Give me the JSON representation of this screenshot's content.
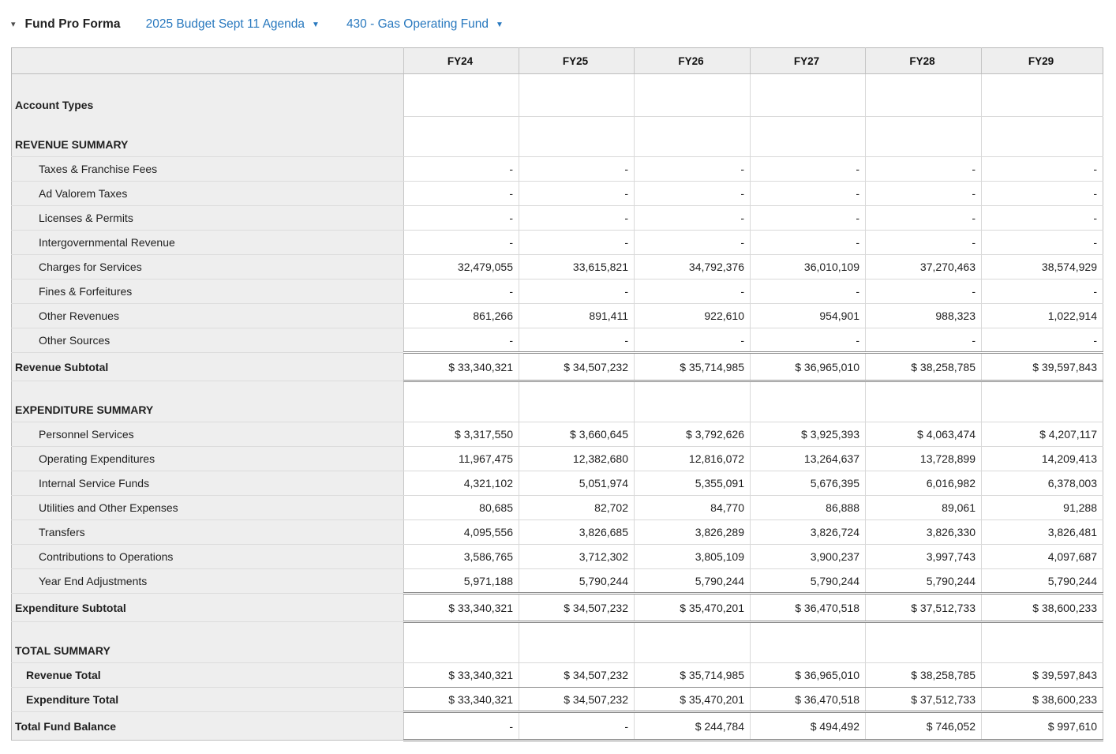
{
  "header": {
    "collapse_icon": "chevron-down-icon",
    "collapse_glyph": "▾",
    "title": "Fund Pro Forma",
    "dropdowns": [
      {
        "label": "2025 Budget Sept 11 Agenda",
        "caret": "▼"
      },
      {
        "label": "430 - Gas Operating Fund",
        "caret": "▼"
      }
    ]
  },
  "colors": {
    "accent_blue": "#2878BE",
    "label_column_bg": "#EEEEEE",
    "grid_border": "#D9D9D9",
    "accounting_border": "#8A8A8A"
  },
  "table": {
    "columns": [
      "FY24",
      "FY25",
      "FY26",
      "FY27",
      "FY28",
      "FY29"
    ],
    "rows": [
      {
        "label": "Account Types",
        "type": "section_start",
        "values": [
          "",
          "",
          "",
          "",
          "",
          ""
        ]
      },
      {
        "label": "REVENUE SUMMARY",
        "type": "section_end",
        "values": [
          "",
          "",
          "",
          "",
          "",
          ""
        ]
      },
      {
        "label": "Taxes & Franchise Fees",
        "type": "detail",
        "values": [
          "-",
          "-",
          "-",
          "-",
          "-",
          "-"
        ]
      },
      {
        "label": "Ad Valorem Taxes",
        "type": "detail",
        "values": [
          "-",
          "-",
          "-",
          "-",
          "-",
          "-"
        ]
      },
      {
        "label": "Licenses & Permits",
        "type": "detail",
        "values": [
          "-",
          "-",
          "-",
          "-",
          "-",
          "-"
        ]
      },
      {
        "label": "Intergovernmental Revenue",
        "type": "detail",
        "values": [
          "-",
          "-",
          "-",
          "-",
          "-",
          "-"
        ]
      },
      {
        "label": "Charges for Services",
        "type": "detail",
        "values": [
          "32,479,055",
          "33,615,821",
          "34,792,376",
          "36,010,109",
          "37,270,463",
          "38,574,929"
        ]
      },
      {
        "label": "Fines & Forfeitures",
        "type": "detail",
        "values": [
          "-",
          "-",
          "-",
          "-",
          "-",
          "-"
        ]
      },
      {
        "label": "Other Revenues",
        "type": "detail",
        "values": [
          "861,266",
          "891,411",
          "922,610",
          "954,901",
          "988,323",
          "1,022,914"
        ]
      },
      {
        "label": "Other Sources",
        "type": "detail",
        "values": [
          "-",
          "-",
          "-",
          "-",
          "-",
          "-"
        ]
      },
      {
        "label": "Revenue Subtotal",
        "type": "subtotal",
        "values": [
          "$ 33,340,321",
          "$ 34,507,232",
          "$ 35,714,985",
          "$ 36,965,010",
          "$ 38,258,785",
          "$ 39,597,843"
        ]
      },
      {
        "label": "EXPENDITURE SUMMARY",
        "type": "section_tall",
        "values": [
          "",
          "",
          "",
          "",
          "",
          ""
        ]
      },
      {
        "label": "Personnel Services",
        "type": "detail",
        "values": [
          "$ 3,317,550",
          "$ 3,660,645",
          "$ 3,792,626",
          "$ 3,925,393",
          "$ 4,063,474",
          "$ 4,207,117"
        ]
      },
      {
        "label": "Operating Expenditures",
        "type": "detail",
        "values": [
          "11,967,475",
          "12,382,680",
          "12,816,072",
          "13,264,637",
          "13,728,899",
          "14,209,413"
        ]
      },
      {
        "label": "Internal Service Funds",
        "type": "detail",
        "values": [
          "4,321,102",
          "5,051,974",
          "5,355,091",
          "5,676,395",
          "6,016,982",
          "6,378,003"
        ]
      },
      {
        "label": "Utilities and Other Expenses",
        "type": "detail",
        "values": [
          "80,685",
          "82,702",
          "84,770",
          "86,888",
          "89,061",
          "91,288"
        ]
      },
      {
        "label": "Transfers",
        "type": "detail",
        "values": [
          "4,095,556",
          "3,826,685",
          "3,826,289",
          "3,826,724",
          "3,826,330",
          "3,826,481"
        ]
      },
      {
        "label": "Contributions to Operations",
        "type": "detail",
        "values": [
          "3,586,765",
          "3,712,302",
          "3,805,109",
          "3,900,237",
          "3,997,743",
          "4,097,687"
        ]
      },
      {
        "label": "Year End Adjustments",
        "type": "detail",
        "values": [
          "5,971,188",
          "5,790,244",
          "5,790,244",
          "5,790,244",
          "5,790,244",
          "5,790,244"
        ]
      },
      {
        "label": "Expenditure Subtotal",
        "type": "subtotal",
        "values": [
          "$ 33,340,321",
          "$ 34,507,232",
          "$ 35,470,201",
          "$ 36,470,518",
          "$ 37,512,733",
          "$ 38,600,233"
        ]
      },
      {
        "label": "TOTAL SUMMARY",
        "type": "section_tall",
        "values": [
          "",
          "",
          "",
          "",
          "",
          ""
        ]
      },
      {
        "label": "Revenue Total",
        "type": "total",
        "values": [
          "$ 33,340,321",
          "$ 34,507,232",
          "$ 35,714,985",
          "$ 36,965,010",
          "$ 38,258,785",
          "$ 39,597,843"
        ]
      },
      {
        "label": "Expenditure Total",
        "type": "total",
        "values": [
          "$ 33,340,321",
          "$ 34,507,232",
          "$ 35,470,201",
          "$ 36,470,518",
          "$ 37,512,733",
          "$ 38,600,233"
        ]
      },
      {
        "label": "Total Fund Balance",
        "type": "grand",
        "values": [
          "-",
          "-",
          "$ 244,784",
          "$ 494,492",
          "$ 746,052",
          "$ 997,610"
        ]
      }
    ]
  }
}
